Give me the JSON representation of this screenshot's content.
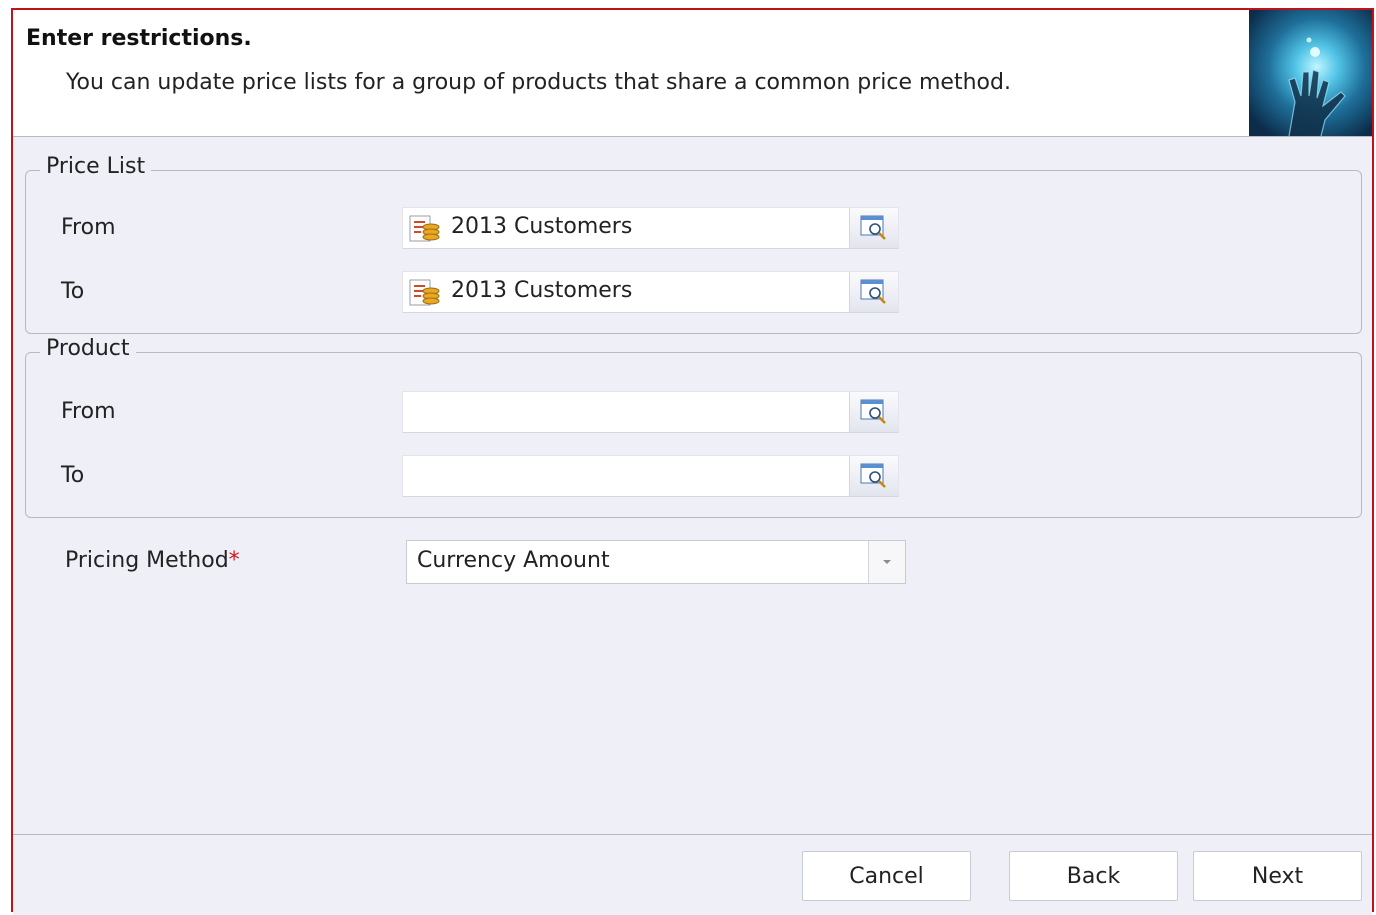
{
  "header": {
    "title": "Enter restrictions.",
    "subtitle": "You can update price lists for a group of products that share a common price method."
  },
  "price_list": {
    "legend": "Price List",
    "from": {
      "label": "From",
      "value": "2013 Customers"
    },
    "to": {
      "label": "To",
      "value": "2013 Customers"
    }
  },
  "product": {
    "legend": "Product",
    "from": {
      "label": "From",
      "value": ""
    },
    "to": {
      "label": "To",
      "value": ""
    }
  },
  "pricing_method": {
    "label": "Pricing Method",
    "required_mark": "*",
    "value": "Currency Amount"
  },
  "footer": {
    "cancel": "Cancel",
    "back": "Back",
    "next": "Next"
  },
  "colors": {
    "frame_border": "#c0121b",
    "background": "#eeeff7",
    "required": "#d2151d"
  }
}
